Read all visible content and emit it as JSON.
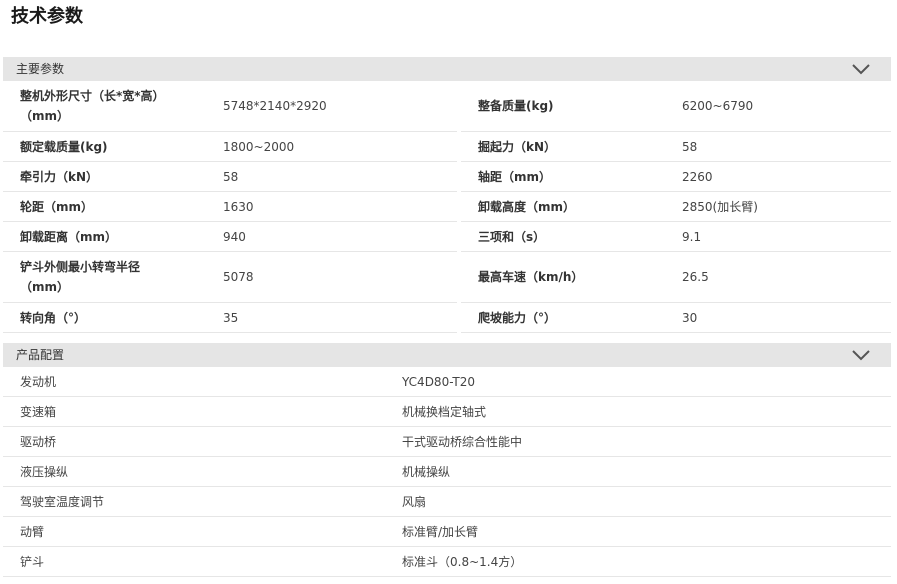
{
  "page": {
    "title": "技术参数"
  },
  "main_section": {
    "title": "主要参数",
    "rows": [
      {
        "k1": "整机外形尺寸（长*宽*高）",
        "k1b": "（mm）",
        "v1": "5748*2140*2920",
        "k2": "整备质量(kg)",
        "v2": "6200~6790"
      },
      {
        "k1": "额定载质量(kg)",
        "v1": "1800~2000",
        "k2": "掘起力（kN）",
        "v2": "58"
      },
      {
        "k1": "牵引力（kN）",
        "v1": "58",
        "k2": "轴距（mm）",
        "v2": "2260"
      },
      {
        "k1": "轮距（mm）",
        "v1": "1630",
        "k2": "卸载高度（mm）",
        "v2": "2850(加长臂)"
      },
      {
        "k1": "卸载距离（mm）",
        "v1": "940",
        "k2": "三项和（s）",
        "v2": "9.1"
      },
      {
        "k1": "铲斗外侧最小转弯半径",
        "k1b": "（mm）",
        "v1": "5078",
        "k2": "最高车速（km/h）",
        "v2": "26.5"
      },
      {
        "k1": "转向角（°）",
        "v1": "35",
        "k2": "爬坡能力（°）",
        "v2": "30"
      }
    ]
  },
  "config_section": {
    "title": "产品配置",
    "rows": [
      {
        "k": "发动机",
        "v": "YC4D80-T20"
      },
      {
        "k": "变速箱",
        "v": "机械换档定轴式"
      },
      {
        "k": "驱动桥",
        "v": "干式驱动桥综合性能中"
      },
      {
        "k": "液压操纵",
        "v": "机械操纵"
      },
      {
        "k": "驾驶室温度调节",
        "v": "风扇"
      },
      {
        "k": "动臂",
        "v": "标准臂/加长臂"
      },
      {
        "k": "铲斗",
        "v": "标准斗（0.8~1.4方）"
      }
    ]
  },
  "icons": {
    "collapse": "chevron-down-icon"
  }
}
